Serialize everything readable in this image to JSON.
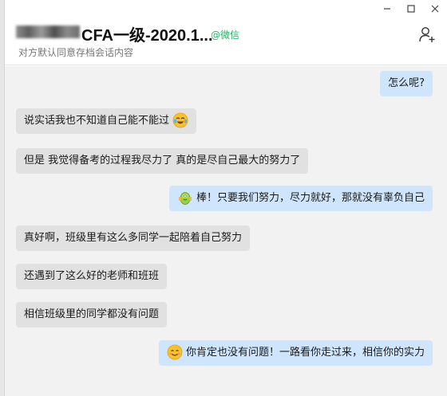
{
  "window": {
    "minimize_icon": "minimize-icon",
    "maximize_icon": "maximize-icon",
    "close_icon": "close-icon"
  },
  "header": {
    "title": "CFA一级-2020.1...",
    "source": "@微信",
    "subtitle": "对方默认同意存档会话内容",
    "add_member_icon": "add-person-icon"
  },
  "messages": [
    {
      "direction": "outgoing",
      "text": "怎么呢?"
    },
    {
      "direction": "incoming",
      "text": "说实话我也不知道自己能不能过",
      "emoji": "laughing-crying-face"
    },
    {
      "direction": "incoming",
      "text": "但是 我觉得备考的过程我尽力了 真的是尽自己最大的努力了"
    },
    {
      "direction": "outgoing",
      "emoji": "pickle-thumbs-up",
      "text": "棒！只要我们努力，尽力就好，那就没有辜负自己"
    },
    {
      "direction": "incoming",
      "text": "真好啊，班级里有这么多同学一起陪着自己努力"
    },
    {
      "direction": "incoming",
      "text": "还遇到了这么好的老师和班班"
    },
    {
      "direction": "incoming",
      "text": "相信班级里的同学都没有问题"
    },
    {
      "direction": "outgoing",
      "emoji": "smiling-face",
      "text": "你肯定也没有问题！一路看你走过来，相信你的实力"
    }
  ],
  "colors": {
    "incoming_bubble": "#e1e1e1",
    "outgoing_bubble": "#cfe5fc",
    "source_green": "#2aae67",
    "chat_background": "#f2f2f2"
  }
}
